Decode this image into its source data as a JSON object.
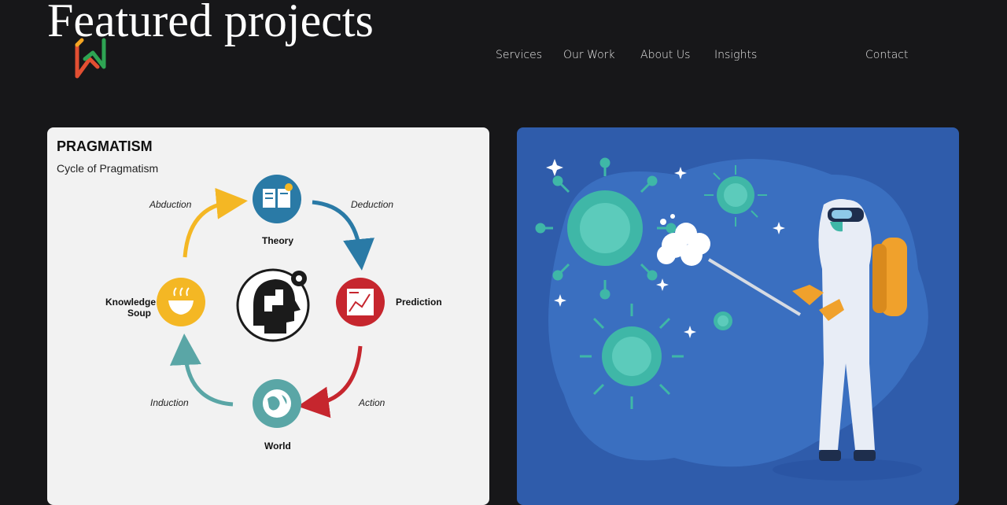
{
  "header": {
    "title": "Featured projects",
    "logo_icon": "zigzag-arrows-logo-icon",
    "nav": [
      {
        "label": "Services"
      },
      {
        "label": "Our Work"
      },
      {
        "label": "About Us"
      },
      {
        "label": "Insights"
      },
      {
        "label": "Contact"
      }
    ]
  },
  "projects": [
    {
      "image": "pragmatism-cycle-diagram",
      "diagram": {
        "title": "PRAGMATISM",
        "subtitle": "Cycle of Pragmatism",
        "nodes": {
          "theory": "Theory",
          "prediction": "Prediction",
          "world": "World",
          "knowledge": "Knowledge Soup"
        },
        "edges": {
          "abduction": "Abduction",
          "deduction": "Deduction",
          "action": "Action",
          "induction": "Induction"
        },
        "colors": {
          "theory": "#2a7aa6",
          "prediction": "#c6262e",
          "world": "#5aa6a6",
          "knowledge": "#f4b724"
        }
      }
    },
    {
      "image": "virus-disinfection-illustration",
      "colors": {
        "background": "#2f5cab",
        "virus": "#3fb7a7",
        "tank": "#f0a12c"
      }
    }
  ]
}
